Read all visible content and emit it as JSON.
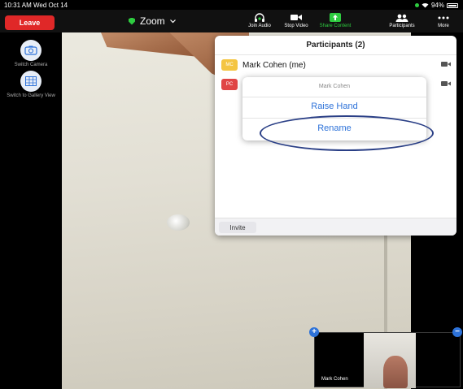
{
  "status_bar": {
    "time": "10:31 AM  Wed Oct 14",
    "battery": "94%"
  },
  "toolbar": {
    "leave_label": "Leave",
    "title": "Zoom",
    "join_audio": "Join Audio",
    "stop_video": "Stop Video",
    "share_content": "Share Content",
    "participants": "Participants",
    "more": "More"
  },
  "left_rail": {
    "switch_camera": "Switch Camera",
    "gallery_view": "Switch to Gallery View"
  },
  "participants_panel": {
    "title": "Participants (2)",
    "rows": [
      {
        "initials": "MC",
        "name": "Mark Cohen (me)",
        "color": "#f4c542"
      },
      {
        "initials": "PC",
        "name": "",
        "color": "#e04545"
      }
    ],
    "invite_label": "Invite"
  },
  "action_menu": {
    "header": "Mark Cohen",
    "items": [
      "Raise Hand",
      "Rename"
    ]
  },
  "self_view": {
    "name": "Mark Cohen"
  },
  "colors": {
    "leave": "#e02828",
    "accent_blue": "#2d72d9",
    "share_green": "#2ecc40",
    "annotation_oval": "#2a3f86"
  }
}
